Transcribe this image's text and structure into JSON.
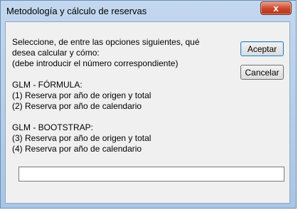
{
  "window": {
    "title": "Metodología y cálculo de reservas",
    "close_label": "x"
  },
  "dialog": {
    "prompt": "Seleccione, de entre las opciones siguientes, qué\ndesea calcular y cómo:\n(debe introducir el número correspondiente)\n\nGLM - FÓRMULA:\n(1) Reserva por año de origen y total\n(2) Reserva por año de calendario\n\nGLM - BOOTSTRAP:\n(3) Reserva por año de origen y total\n(4) Reserva por año de calendario",
    "ok_label": "Aceptar",
    "cancel_label": "Cancelar",
    "input_value": ""
  }
}
